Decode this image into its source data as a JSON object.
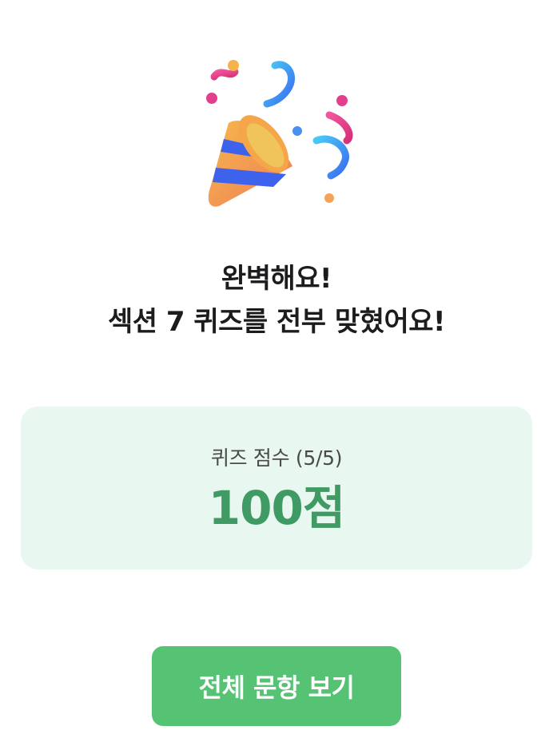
{
  "icon": {
    "name": "party-popper-icon"
  },
  "headline": {
    "line1": "완벽해요!",
    "line2": "섹션 7 퀴즈를 전부 맞혔어요!"
  },
  "score_card": {
    "label": "퀴즈 점수 (5/5)",
    "value": "100점",
    "background_color": "#e8f7ef",
    "value_color": "#3f9a63"
  },
  "view_all_button": {
    "label": "전체 문항 보기",
    "color": "#56c274"
  }
}
